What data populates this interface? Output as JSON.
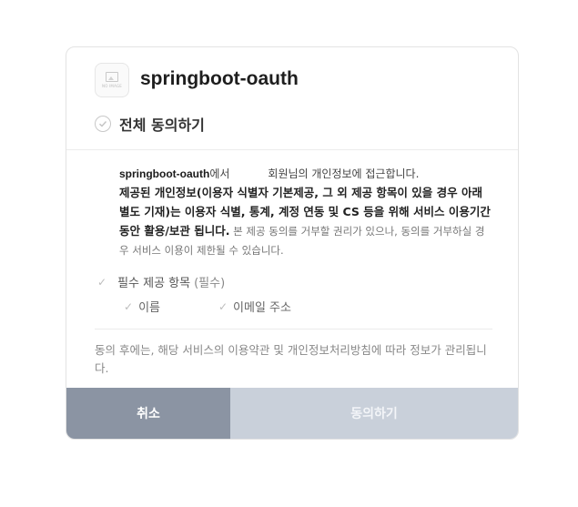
{
  "app": {
    "name": "springboot-oauth",
    "logo_text": "NO IMAGE"
  },
  "agree_all": {
    "label": "전체 동의하기"
  },
  "description": {
    "app_name": "springboot-oauth",
    "suffix_from": "에서",
    "suffix_member": "회원님의 개인정보에 접근합니다.",
    "bold_text": "제공된 개인정보(이용자 식별자 기본제공, 그 외 제공 항목이 있을 경우 아래 별도 기재)는 이용자 식별, 통계, 계정 연동 및 CS 등을 위해 서비스 이용기간 동안 활용/보관 됩니다.",
    "light_text": " 본 제공 동의를 거부할 권리가 있으나, 동의를 거부하실 경우 서비스 이용이 제한될 수 있습니다."
  },
  "required_section": {
    "label": "필수 제공 항목",
    "tag": "(필수)",
    "items": [
      "이름",
      "이메일 주소"
    ]
  },
  "notice": "동의 후에는, 해당 서비스의 이용약관 및 개인정보처리방침에 따라 정보가 관리됩니다.",
  "buttons": {
    "cancel": "취소",
    "agree": "동의하기"
  },
  "colors": {
    "cancel_bg": "#8b94a3",
    "agree_bg": "#c9d0da"
  }
}
